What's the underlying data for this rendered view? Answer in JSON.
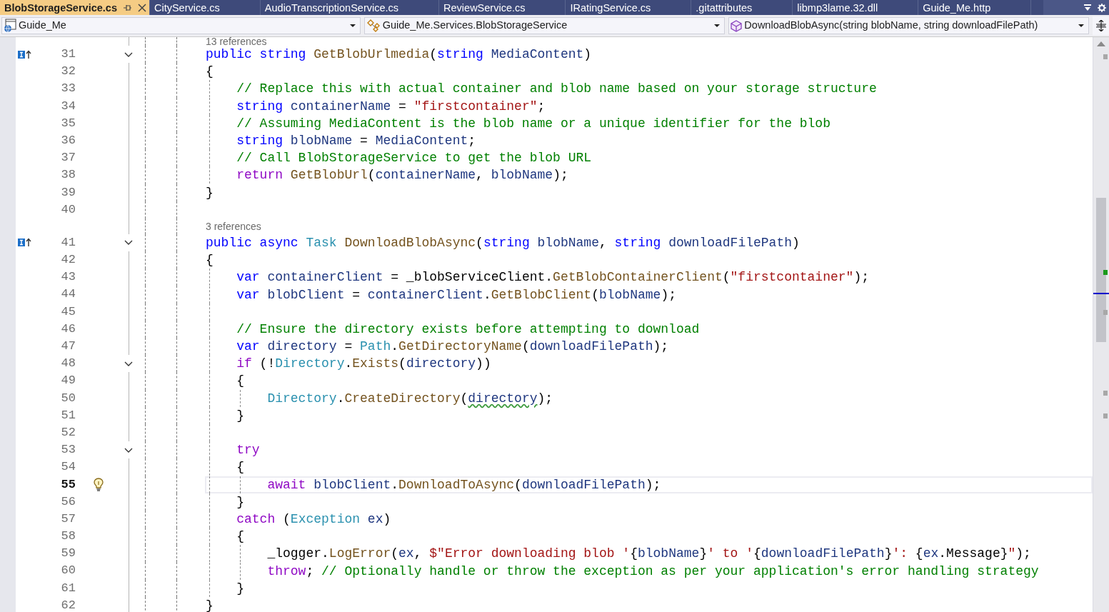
{
  "tabs": [
    {
      "label": "BlobStorageService.cs",
      "selected": true
    },
    {
      "label": "CityService.cs",
      "selected": false
    },
    {
      "label": "AudioTranscriptionService.cs",
      "selected": false
    },
    {
      "label": "ReviewService.cs",
      "selected": false
    },
    {
      "label": "IRatingService.cs",
      "selected": false
    },
    {
      "label": ".gitattributes",
      "selected": false
    },
    {
      "label": "libmp3lame.32.dll",
      "selected": false
    },
    {
      "label": "Guide_Me.http",
      "selected": false
    }
  ],
  "navigation_bar": {
    "project": "Guide_Me",
    "type": "Guide_Me.Services.BlobStorageService",
    "member": "DownloadBlobAsync(string blobName, string downloadFilePath)"
  },
  "editor": {
    "lines": [
      {
        "kind": "lens",
        "text": "13 references",
        "partial": true
      },
      {
        "kind": "code",
        "number": "31",
        "glyph": {
          "kind": "override"
        },
        "foldable": true,
        "current": false,
        "tokens": [
          {
            "kind": "kw",
            "text": "public string "
          },
          {
            "kind": "method",
            "text": "GetBlobUrlmedia"
          },
          {
            "kind": "plain",
            "text": "("
          },
          {
            "kind": "kw",
            "text": "string "
          },
          {
            "kind": "var",
            "text": "MediaContent"
          },
          {
            "kind": "plain",
            "text": ")"
          }
        ]
      },
      {
        "kind": "code",
        "number": "32",
        "foldable": false,
        "current": false,
        "tokens": [
          {
            "kind": "plain",
            "text": "{"
          }
        ]
      },
      {
        "kind": "code",
        "number": "33",
        "foldable": false,
        "current": false,
        "indent": {
          "kind": "inner"
        },
        "tokens": [
          {
            "kind": "cmt",
            "text": "// Replace this with actual container and blob name based on your storage structure"
          }
        ]
      },
      {
        "kind": "code",
        "number": "34",
        "foldable": false,
        "current": false,
        "indent": {
          "kind": "inner"
        },
        "tokens": [
          {
            "kind": "kw",
            "text": "string "
          },
          {
            "kind": "var",
            "text": "containerName"
          },
          {
            "kind": "plain",
            "text": " = "
          },
          {
            "kind": "str",
            "text": "\"firstcontainer\""
          },
          {
            "kind": "plain",
            "text": ";"
          }
        ]
      },
      {
        "kind": "code",
        "number": "35",
        "foldable": false,
        "current": false,
        "indent": {
          "kind": "inner"
        },
        "tokens": [
          {
            "kind": "cmt",
            "text": "// Assuming MediaContent is the blob name or a unique identifier for the blob"
          }
        ]
      },
      {
        "kind": "code",
        "number": "36",
        "foldable": false,
        "current": false,
        "indent": {
          "kind": "inner"
        },
        "tokens": [
          {
            "kind": "kw",
            "text": "string "
          },
          {
            "kind": "var",
            "text": "blobName"
          },
          {
            "kind": "plain",
            "text": " = "
          },
          {
            "kind": "var",
            "text": "MediaContent"
          },
          {
            "kind": "plain",
            "text": ";"
          }
        ]
      },
      {
        "kind": "code",
        "number": "37",
        "foldable": false,
        "current": false,
        "indent": {
          "kind": "inner"
        },
        "tokens": [
          {
            "kind": "cmt",
            "text": "// Call BlobStorageService to get the blob URL"
          }
        ]
      },
      {
        "kind": "code",
        "number": "38",
        "foldable": false,
        "current": false,
        "indent": {
          "kind": "inner"
        },
        "tokens": [
          {
            "kind": "ctl",
            "text": "return "
          },
          {
            "kind": "method",
            "text": "GetBlobUrl"
          },
          {
            "kind": "plain",
            "text": "("
          },
          {
            "kind": "var",
            "text": "containerName"
          },
          {
            "kind": "plain",
            "text": ", "
          },
          {
            "kind": "var",
            "text": "blobName"
          },
          {
            "kind": "plain",
            "text": ");"
          }
        ]
      },
      {
        "kind": "code",
        "number": "39",
        "foldable": false,
        "current": false,
        "tokens": [
          {
            "kind": "plain",
            "text": "}"
          }
        ]
      },
      {
        "kind": "code",
        "number": "40",
        "foldable": false,
        "current": false
      },
      {
        "kind": "lens",
        "text": "3 references",
        "partial": false
      },
      {
        "kind": "code",
        "number": "41",
        "glyph": {
          "kind": "override"
        },
        "foldable": true,
        "current": false,
        "tokens": [
          {
            "kind": "kw",
            "text": "public async "
          },
          {
            "kind": "type",
            "text": "Task "
          },
          {
            "kind": "method",
            "text": "DownloadBlobAsync"
          },
          {
            "kind": "plain",
            "text": "("
          },
          {
            "kind": "kw",
            "text": "string "
          },
          {
            "kind": "var",
            "text": "blobName"
          },
          {
            "kind": "plain",
            "text": ", "
          },
          {
            "kind": "kw",
            "text": "string "
          },
          {
            "kind": "var",
            "text": "downloadFilePath"
          },
          {
            "kind": "plain",
            "text": ")"
          }
        ]
      },
      {
        "kind": "code",
        "number": "42",
        "foldable": false,
        "current": false,
        "tokens": [
          {
            "kind": "plain",
            "text": "{"
          }
        ]
      },
      {
        "kind": "code",
        "number": "43",
        "foldable": false,
        "current": false,
        "indent": {
          "kind": "inner"
        },
        "tokens": [
          {
            "kind": "kw",
            "text": "var "
          },
          {
            "kind": "var",
            "text": "containerClient"
          },
          {
            "kind": "plain",
            "text": " = _blobServiceClient."
          },
          {
            "kind": "method",
            "text": "GetBlobContainerClient"
          },
          {
            "kind": "plain",
            "text": "("
          },
          {
            "kind": "str",
            "text": "\"firstcontainer\""
          },
          {
            "kind": "plain",
            "text": ");"
          }
        ]
      },
      {
        "kind": "code",
        "number": "44",
        "foldable": false,
        "current": false,
        "indent": {
          "kind": "inner"
        },
        "tokens": [
          {
            "kind": "kw",
            "text": "var "
          },
          {
            "kind": "var",
            "text": "blobClient"
          },
          {
            "kind": "plain",
            "text": " = "
          },
          {
            "kind": "var",
            "text": "containerClient"
          },
          {
            "kind": "plain",
            "text": "."
          },
          {
            "kind": "method",
            "text": "GetBlobClient"
          },
          {
            "kind": "plain",
            "text": "("
          },
          {
            "kind": "var",
            "text": "blobName"
          },
          {
            "kind": "plain",
            "text": ");"
          }
        ]
      },
      {
        "kind": "code",
        "number": "45",
        "foldable": false,
        "current": false,
        "indent": {
          "kind": "inner"
        }
      },
      {
        "kind": "code",
        "number": "46",
        "foldable": false,
        "current": false,
        "indent": {
          "kind": "inner"
        },
        "tokens": [
          {
            "kind": "cmt",
            "text": "// Ensure the directory exists before attempting to download"
          }
        ]
      },
      {
        "kind": "code",
        "number": "47",
        "foldable": false,
        "current": false,
        "indent": {
          "kind": "inner"
        },
        "tokens": [
          {
            "kind": "kw",
            "text": "var "
          },
          {
            "kind": "var",
            "text": "directory"
          },
          {
            "kind": "plain",
            "text": " = "
          },
          {
            "kind": "type",
            "text": "Path"
          },
          {
            "kind": "plain",
            "text": "."
          },
          {
            "kind": "method",
            "text": "GetDirectoryName"
          },
          {
            "kind": "plain",
            "text": "("
          },
          {
            "kind": "var",
            "text": "downloadFilePath"
          },
          {
            "kind": "plain",
            "text": ");"
          }
        ]
      },
      {
        "kind": "code",
        "number": "48",
        "foldable": true,
        "current": false,
        "indent": {
          "kind": "inner"
        },
        "tokens": [
          {
            "kind": "ctl",
            "text": "if"
          },
          {
            "kind": "plain",
            "text": " (!"
          },
          {
            "kind": "type",
            "text": "Directory"
          },
          {
            "kind": "plain",
            "text": "."
          },
          {
            "kind": "method",
            "text": "Exists"
          },
          {
            "kind": "plain",
            "text": "("
          },
          {
            "kind": "var",
            "text": "directory"
          },
          {
            "kind": "plain",
            "text": "))"
          }
        ]
      },
      {
        "kind": "code",
        "number": "49",
        "foldable": false,
        "current": false,
        "indent": {
          "kind": "inner"
        },
        "tokens": [
          {
            "kind": "plain",
            "text": "{"
          }
        ]
      },
      {
        "kind": "code",
        "number": "50",
        "foldable": false,
        "current": false,
        "indent": {
          "kind": "innermost"
        },
        "tokens": [
          {
            "kind": "type",
            "text": "Directory"
          },
          {
            "kind": "plain",
            "text": "."
          },
          {
            "kind": "method",
            "text": "CreateDirectory"
          },
          {
            "kind": "plain",
            "text": "("
          },
          {
            "kind": "var",
            "text": "directory",
            "squiggle": true
          },
          {
            "kind": "plain",
            "text": ");"
          }
        ]
      },
      {
        "kind": "code",
        "number": "51",
        "foldable": false,
        "current": false,
        "indent": {
          "kind": "inner"
        },
        "tokens": [
          {
            "kind": "plain",
            "text": "}"
          }
        ]
      },
      {
        "kind": "code",
        "number": "52",
        "foldable": false,
        "current": false,
        "indent": {
          "kind": "inner"
        }
      },
      {
        "kind": "code",
        "number": "53",
        "foldable": true,
        "current": false,
        "indent": {
          "kind": "inner"
        },
        "tokens": [
          {
            "kind": "ctl",
            "text": "try"
          }
        ]
      },
      {
        "kind": "code",
        "number": "54",
        "foldable": false,
        "current": false,
        "indent": {
          "kind": "inner"
        },
        "tokens": [
          {
            "kind": "plain",
            "text": "{"
          }
        ]
      },
      {
        "kind": "code",
        "number": "55",
        "glyph": {
          "kind": "lightbulb"
        },
        "foldable": false,
        "current": true,
        "indent": {
          "kind": "innermost"
        },
        "tokens": [
          {
            "kind": "ctl",
            "text": "await "
          },
          {
            "kind": "var",
            "text": "blobClient"
          },
          {
            "kind": "plain",
            "text": "."
          },
          {
            "kind": "method",
            "text": "DownloadToAsync"
          },
          {
            "kind": "plain",
            "text": "("
          },
          {
            "kind": "var",
            "text": "downloadFilePath"
          },
          {
            "kind": "plain",
            "text": ");"
          }
        ]
      },
      {
        "kind": "code",
        "number": "56",
        "foldable": false,
        "current": false,
        "indent": {
          "kind": "inner"
        },
        "tokens": [
          {
            "kind": "plain",
            "text": "}"
          }
        ]
      },
      {
        "kind": "code",
        "number": "57",
        "foldable": false,
        "current": false,
        "indent": {
          "kind": "inner"
        },
        "tokens": [
          {
            "kind": "ctl",
            "text": "catch"
          },
          {
            "kind": "plain",
            "text": " ("
          },
          {
            "kind": "type",
            "text": "Exception "
          },
          {
            "kind": "var",
            "text": "ex"
          },
          {
            "kind": "plain",
            "text": ")"
          }
        ]
      },
      {
        "kind": "code",
        "number": "58",
        "foldable": false,
        "current": false,
        "indent": {
          "kind": "inner"
        },
        "tokens": [
          {
            "kind": "plain",
            "text": "{"
          }
        ]
      },
      {
        "kind": "code",
        "number": "59",
        "foldable": false,
        "current": false,
        "indent": {
          "kind": "innermost"
        },
        "tokens": [
          {
            "kind": "plain",
            "text": "_logger."
          },
          {
            "kind": "method",
            "text": "LogError"
          },
          {
            "kind": "plain",
            "text": "("
          },
          {
            "kind": "var",
            "text": "ex"
          },
          {
            "kind": "plain",
            "text": ", "
          },
          {
            "kind": "str",
            "text": "$\"Error downloading blob '"
          },
          {
            "kind": "plain",
            "text": "{"
          },
          {
            "kind": "var",
            "text": "blobName"
          },
          {
            "kind": "plain",
            "text": "}"
          },
          {
            "kind": "str",
            "text": "' to '"
          },
          {
            "kind": "plain",
            "text": "{"
          },
          {
            "kind": "var",
            "text": "downloadFilePath"
          },
          {
            "kind": "plain",
            "text": "}"
          },
          {
            "kind": "str",
            "text": "': "
          },
          {
            "kind": "plain",
            "text": "{"
          },
          {
            "kind": "var",
            "text": "ex"
          },
          {
            "kind": "plain",
            "text": ".Message}"
          },
          {
            "kind": "str",
            "text": "\""
          },
          {
            "kind": "plain",
            "text": ");"
          }
        ]
      },
      {
        "kind": "code",
        "number": "60",
        "foldable": false,
        "current": false,
        "indent": {
          "kind": "innermost"
        },
        "tokens": [
          {
            "kind": "ctl",
            "text": "throw"
          },
          {
            "kind": "plain",
            "text": "; "
          },
          {
            "kind": "cmt",
            "text": "// Optionally handle or throw the exception as per your application's error handling strategy"
          }
        ]
      },
      {
        "kind": "code",
        "number": "61",
        "foldable": false,
        "current": false,
        "indent": {
          "kind": "inner"
        },
        "tokens": [
          {
            "kind": "plain",
            "text": "}"
          }
        ]
      },
      {
        "kind": "code",
        "number": "62",
        "foldable": false,
        "current": false,
        "tokens": [
          {
            "kind": "plain",
            "text": "}"
          }
        ]
      }
    ]
  }
}
